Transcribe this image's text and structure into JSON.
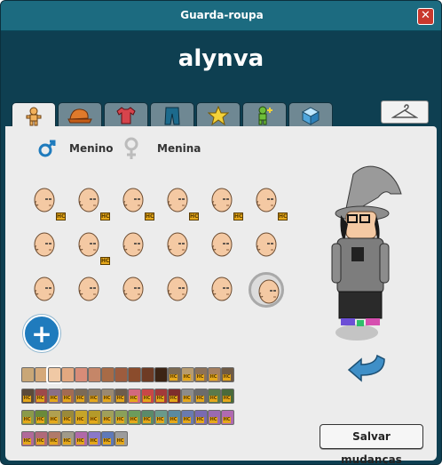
{
  "window": {
    "title": "Guarda-roupa",
    "close_label": "✕"
  },
  "username": "alynva",
  "tabs": [
    {
      "icon": "body-icon",
      "active": true
    },
    {
      "icon": "cap-icon",
      "active": false
    },
    {
      "icon": "shirt-icon",
      "active": false
    },
    {
      "icon": "pants-icon",
      "active": false
    },
    {
      "icon": "star-icon",
      "active": false
    },
    {
      "icon": "add-effect-icon",
      "active": false
    },
    {
      "icon": "cube-icon",
      "active": false
    }
  ],
  "hanger_icon": "hanger-icon",
  "gender": {
    "male_label": "Menino",
    "female_label": "Menina",
    "selected": "male"
  },
  "heads": [
    {
      "hc": true
    },
    {
      "hc": true
    },
    {
      "hc": true
    },
    {
      "hc": true
    },
    {
      "hc": true
    },
    {
      "hc": true
    },
    {
      "hc": false
    },
    {
      "hc": true
    },
    {
      "hc": false
    },
    {
      "hc": false
    },
    {
      "hc": false
    },
    {
      "hc": false
    },
    {
      "hc": false
    },
    {
      "hc": false
    },
    {
      "hc": false
    },
    {
      "hc": false
    },
    {
      "hc": false
    },
    {
      "hc": false,
      "selected": true
    }
  ],
  "add_label": "+",
  "swatches": [
    {
      "color": "#c9a777",
      "hc": false
    },
    {
      "color": "#d5a97a",
      "hc": false
    },
    {
      "color": "#f0c9a5",
      "hc": false,
      "selected": true
    },
    {
      "color": "#e3a880",
      "hc": false
    },
    {
      "color": "#d88c78",
      "hc": false
    },
    {
      "color": "#c58668",
      "hc": false
    },
    {
      "color": "#a86b46",
      "hc": false
    },
    {
      "color": "#9d5c3e",
      "hc": false
    },
    {
      "color": "#8b4c2c",
      "hc": false
    },
    {
      "color": "#6e3b24",
      "hc": false
    },
    {
      "color": "#3c2414",
      "hc": false
    },
    {
      "color": "#7c6a52",
      "hc": true
    },
    {
      "color": "#b89c6f",
      "hc": true
    },
    {
      "color": "#8d7157",
      "hc": true
    },
    {
      "color": "#a57f5f",
      "hc": true
    },
    {
      "color": "#6f5a44",
      "hc": true
    },
    {
      "color": "#5b4a3a",
      "hc": true
    },
    {
      "color": "#9d4a4a",
      "hc": true
    },
    {
      "color": "#8a6f88",
      "hc": true
    },
    {
      "color": "#a36b53",
      "hc": true
    },
    {
      "color": "#7b6a56",
      "hc": true
    },
    {
      "color": "#8c7b66",
      "hc": true
    },
    {
      "color": "#9a8972",
      "hc": true
    },
    {
      "color": "#6d5c4c",
      "hc": true
    },
    {
      "color": "#d2697e",
      "hc": true
    },
    {
      "color": "#c84747",
      "hc": true
    },
    {
      "color": "#a23a3a",
      "hc": true
    },
    {
      "color": "#7d2d2d",
      "hc": true
    },
    {
      "color": "#8c8c8c",
      "hc": true
    },
    {
      "color": "#6c6c6c",
      "hc": true
    },
    {
      "color": "#5a7a4b",
      "hc": true
    },
    {
      "color": "#4a6a3b",
      "hc": true
    },
    {
      "color": "#8a9a4a",
      "hc": true
    },
    {
      "color": "#6a8a3a",
      "hc": true
    },
    {
      "color": "#b0a050",
      "hc": true
    },
    {
      "color": "#9a8a3a",
      "hc": true
    },
    {
      "color": "#c6a52a",
      "hc": true
    },
    {
      "color": "#b49a2a",
      "hc": true
    },
    {
      "color": "#a0a05a",
      "hc": true
    },
    {
      "color": "#8aa05a",
      "hc": true
    },
    {
      "color": "#6c9c5c",
      "hc": true
    },
    {
      "color": "#5a8a6a",
      "hc": true
    },
    {
      "color": "#6a9a8a",
      "hc": true
    },
    {
      "color": "#5a8aa0",
      "hc": true
    },
    {
      "color": "#6a7ab0",
      "hc": true
    },
    {
      "color": "#7a6ab0",
      "hc": true
    },
    {
      "color": "#9a6ab0",
      "hc": true
    },
    {
      "color": "#b06ab0",
      "hc": true
    },
    {
      "color": "#b06a9a",
      "hc": true
    },
    {
      "color": "#b06a7a",
      "hc": true
    },
    {
      "color": "#b07a6a",
      "hc": true
    },
    {
      "color": "#a09a8a",
      "hc": true
    },
    {
      "color": "#b069a8",
      "hc": true
    },
    {
      "color": "#8a78c8",
      "hc": true
    },
    {
      "color": "#5f79b8",
      "hc": true
    },
    {
      "color": "#9c9c9c",
      "hc": true
    }
  ],
  "save_button": "Salvar mudanças",
  "colors": {
    "title_bar": "#1c6b80",
    "header_bg": "#0e3f51",
    "panel_bg": "#ececec",
    "accent": "#1f7bbd"
  }
}
